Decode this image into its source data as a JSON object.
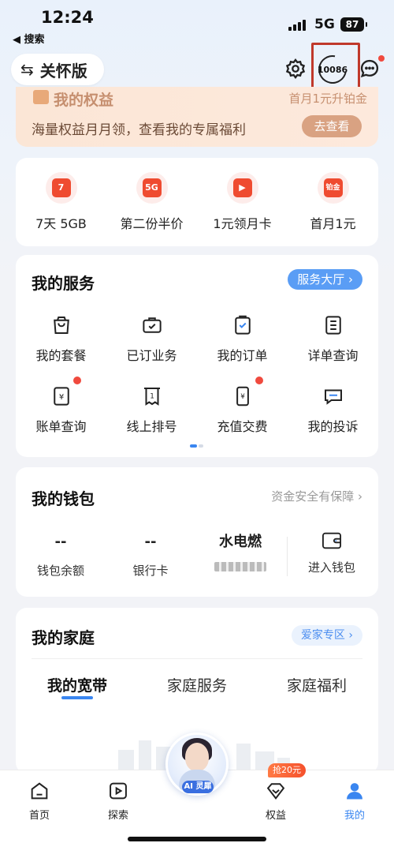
{
  "status_bar": {
    "time": "12:24",
    "back_label": "◀ 搜索",
    "network": "5G",
    "battery": "87"
  },
  "header": {
    "care_mode_label": "关怀版",
    "hotline_label": "10086"
  },
  "rights_banner": {
    "title": "我的权益",
    "upgrade_text": "首月1元升铂金",
    "subtitle": "海量权益月月领，查看我的专属福利",
    "button": "去查看"
  },
  "promos": [
    {
      "label": "7天 5GB",
      "icon": "calendar-icon",
      "glyph": "7"
    },
    {
      "label": "第二份半价",
      "icon": "gift-card-icon",
      "glyph": "5G"
    },
    {
      "label": "1元领月卡",
      "icon": "video-camera-icon",
      "glyph": "▶"
    },
    {
      "label": "首月1元",
      "icon": "crown-icon",
      "glyph": "铂金"
    }
  ],
  "services": {
    "title": "我的服务",
    "hall_button": "服务大厅 ›",
    "items": [
      {
        "label": "我的套餐",
        "icon": "shopping-bag-icon"
      },
      {
        "label": "已订业务",
        "icon": "briefcase-check-icon"
      },
      {
        "label": "我的订单",
        "icon": "clipboard-check-icon"
      },
      {
        "label": "详单查询",
        "icon": "list-document-icon"
      },
      {
        "label": "账单查询",
        "icon": "bill-yen-icon"
      },
      {
        "label": "线上排号",
        "icon": "queue-ticket-icon"
      },
      {
        "label": "充值交费",
        "icon": "phone-yen-icon"
      },
      {
        "label": "我的投诉",
        "icon": "complaint-chat-icon"
      }
    ]
  },
  "wallet": {
    "title": "我的钱包",
    "safety_text": "资金安全有保障 ›",
    "balance_value": "--",
    "balance_label": "钱包余额",
    "bank_value": "--",
    "bank_label": "银行卡",
    "utility_title": "水电燃",
    "enter_label": "进入钱包"
  },
  "family": {
    "title": "我的家庭",
    "zone_button": "爱家专区 ›",
    "tabs": [
      "我的宽带",
      "家庭服务",
      "家庭福利"
    ]
  },
  "tabbar": {
    "items": [
      {
        "label": "首页",
        "icon": "home-icon"
      },
      {
        "label": "探索",
        "icon": "play-square-icon"
      },
      {
        "label": "权益",
        "icon": "diamond-icon"
      },
      {
        "label": "我的",
        "icon": "person-icon"
      }
    ],
    "ai_label": "AI 灵犀",
    "badge": "抢20元"
  },
  "colors": {
    "accent": "#3a86f0",
    "promo_red": "#ef4b30",
    "highlight_box": "#c0392b"
  }
}
